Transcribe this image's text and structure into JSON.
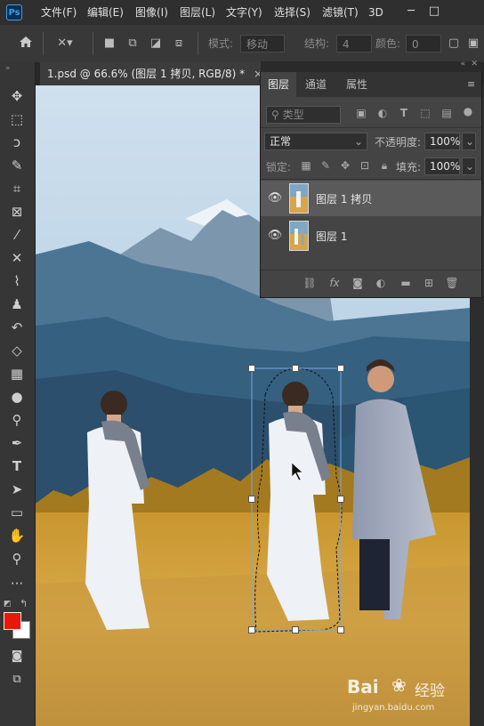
{
  "app": {
    "logo": "Ps"
  },
  "menu": [
    "文件(F)",
    "编辑(E)",
    "图像(I)",
    "图层(L)",
    "文字(Y)",
    "选择(S)",
    "滤镜(T)",
    "3D"
  ],
  "window_controls": {
    "minimize": "─",
    "restore": "□"
  },
  "options_bar": {
    "mode_label": "模式:",
    "mode_value": "移动",
    "structure_label": "结构:",
    "structure_value": "4",
    "color_label": "颜色:",
    "color_value": "0"
  },
  "document_tab": {
    "title": "1.psd @ 66.6% (图层 1 拷贝, RGB/8) *",
    "close": "×"
  },
  "panel": {
    "tabs": [
      "图层",
      "通道",
      "属性"
    ],
    "kind_placeholder": "类型",
    "blend_mode": "正常",
    "opacity_label": "不透明度:",
    "opacity_value": "100%",
    "lock_label": "锁定:",
    "fill_label": "填充:",
    "fill_value": "100%",
    "layers": [
      {
        "name": "图层 1 拷贝",
        "selected": true
      },
      {
        "name": "图层 1",
        "selected": false
      }
    ]
  },
  "colors": {
    "foreground": "#e8170a",
    "background": "#ffffff",
    "accent": "#3aa0f0"
  },
  "watermark": {
    "brand": "Bai",
    "brand_cn": "经验",
    "url": "jingyan.baidu.com"
  }
}
